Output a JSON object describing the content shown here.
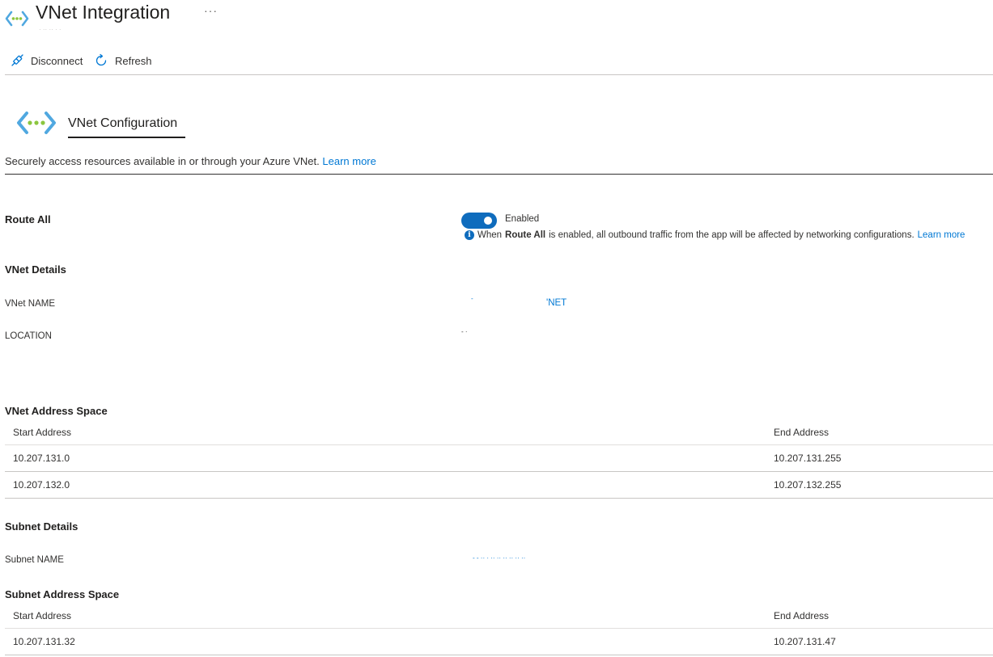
{
  "header": {
    "title": "VNet Integration",
    "more_label": "···",
    "subtitle": "· ·· ·· · ·"
  },
  "toolbar": {
    "disconnect_label": "Disconnect",
    "refresh_label": "Refresh"
  },
  "config": {
    "title": "VNet Configuration",
    "description": "Securely access resources available in or through your Azure VNet.",
    "learn_more": "Learn more"
  },
  "route_all": {
    "label": "Route All",
    "state": "Enabled",
    "enabled": true,
    "info_prefix": "When",
    "info_bold": "Route All",
    "info_suffix": "is enabled, all outbound traffic from the app will be affected by networking configurations.",
    "learn_more": "Learn more"
  },
  "vnet_details": {
    "heading": "VNet Details",
    "name_label": "VNet NAME",
    "name_value_fragment_left": "-",
    "name_value_fragment_right": "'NET",
    "location_label": "LOCATION",
    "location_value_fragment": "- ·"
  },
  "vnet_address_space": {
    "heading": "VNet Address Space",
    "columns": [
      "Start Address",
      "End Address"
    ],
    "rows": [
      [
        "10.207.131.0",
        "10.207.131.255"
      ],
      [
        "10.207.132.0",
        "10.207.132.255"
      ]
    ]
  },
  "subnet_details": {
    "heading": "Subnet Details",
    "name_label": "Subnet NAME",
    "name_value_fragment": "- - ·· ·  ·· ··  ·· ··  ·· ··"
  },
  "subnet_address_space": {
    "heading": "Subnet Address Space",
    "columns": [
      "Start Address",
      "End Address"
    ],
    "rows": [
      [
        "10.207.131.32",
        "10.207.131.47"
      ]
    ]
  },
  "colors": {
    "accent": "#0078d4",
    "toggle_on": "#0f6cbd",
    "icon_green": "#8cc63f",
    "icon_blue": "#50a8e0"
  },
  "icons": {
    "vnet": "vnet-icon",
    "disconnect": "disconnect-icon",
    "refresh": "refresh-icon",
    "info": "info-icon"
  }
}
